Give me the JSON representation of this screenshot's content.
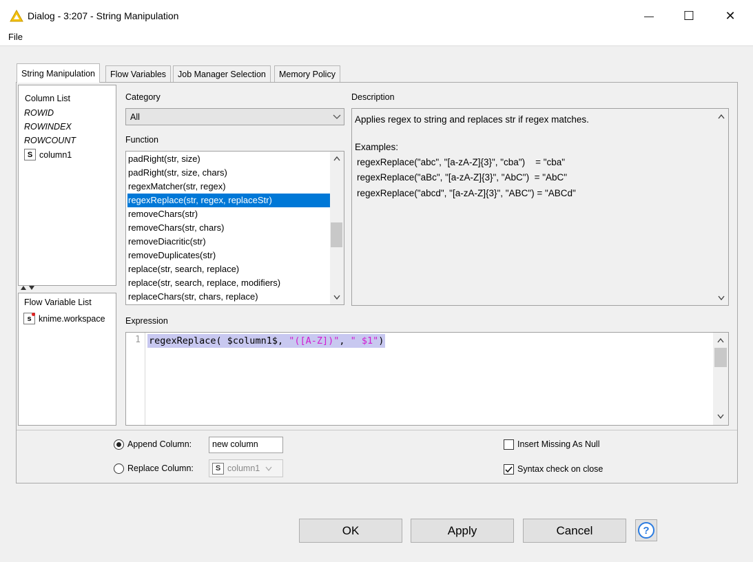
{
  "window": {
    "title": "Dialog - 3:207 - String Manipulation",
    "minimize_glyph": "—",
    "maximize_glyph": "☐",
    "close_glyph": "✕"
  },
  "menu": {
    "file": "File"
  },
  "tabs": [
    {
      "label": "String Manipulation",
      "active": true
    },
    {
      "label": "Flow Variables"
    },
    {
      "label": "Job Manager Selection"
    },
    {
      "label": "Memory Policy"
    }
  ],
  "column_list": {
    "title": "Column List",
    "items": [
      "ROWID",
      "ROWINDEX",
      "ROWCOUNT"
    ],
    "column_type": "S",
    "column_name": "column1"
  },
  "flow_variable_list": {
    "title": "Flow Variable List",
    "type": "s",
    "name": "knime.workspace"
  },
  "category": {
    "label": "Category",
    "value": "All"
  },
  "function": {
    "label": "Function",
    "items": [
      "padRight(str, size)",
      "padRight(str, size, chars)",
      "regexMatcher(str, regex)",
      "regexReplace(str, regex, replaceStr)",
      "removeChars(str)",
      "removeChars(str, chars)",
      "removeDiacritic(str)",
      "removeDuplicates(str)",
      "replace(str, search, replace)",
      "replace(str, search, replace, modifiers)",
      "replaceChars(str, chars, replace)"
    ],
    "selected_index": 3
  },
  "description": {
    "label": "Description",
    "line1": "Applies regex to string and replaces str if regex matches.",
    "examples_label": "Examples:",
    "ex1": "regexReplace(\"abc\", \"[a-zA-Z]{3}\", \"cba\")    = \"cba\"",
    "ex2": "regexReplace(\"aBc\", \"[a-zA-Z]{3}\", \"AbC\")  = \"AbC\"",
    "ex3": "regexReplace(\"abcd\", \"[a-zA-Z]{3}\", \"ABC\") = \"ABCd\""
  },
  "expression": {
    "label": "Expression",
    "line_number": "1",
    "fn": "regexReplace(",
    "col": " $column1$, ",
    "arg1": "\"([A-Z])\"",
    "sep": ", ",
    "arg2": "\" $1\"",
    "close": ")"
  },
  "options": {
    "append_label": "Append Column:",
    "append_value": "new column",
    "replace_label": "Replace Column:",
    "replace_type": "S",
    "replace_value": "column1",
    "insert_missing_label": "Insert Missing As Null",
    "insert_missing_checked": false,
    "syntax_check_label": "Syntax check on close",
    "syntax_check_checked": true
  },
  "buttons": {
    "ok": "OK",
    "apply": "Apply",
    "cancel": "Cancel",
    "help": "?"
  },
  "colors": {
    "selection": "#0078d7",
    "accent": "#2a7be0",
    "code_highlight": "#c8c8f0",
    "string_literal": "#d11bd1",
    "warning_icon": "#f4c20d"
  }
}
